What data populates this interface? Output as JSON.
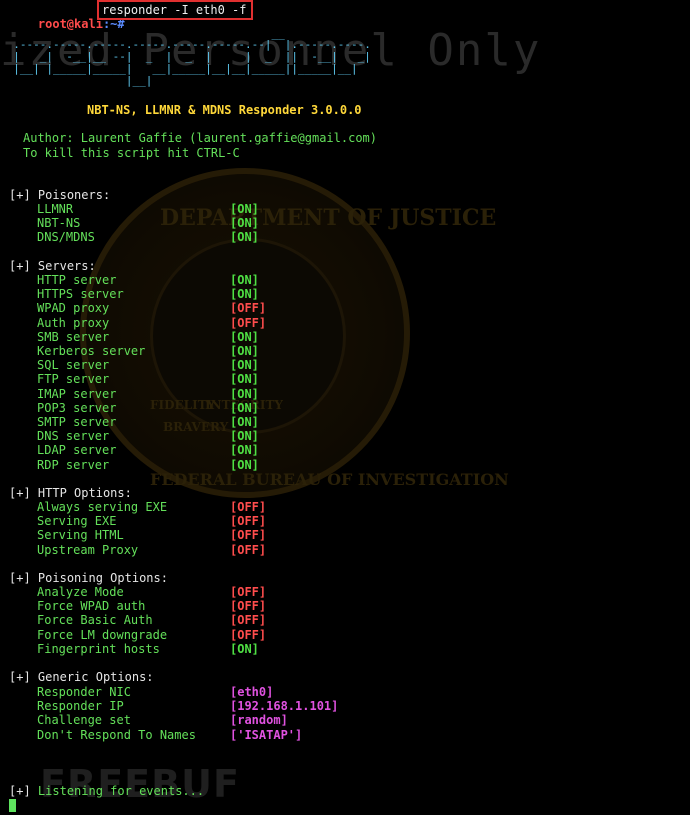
{
  "prompt": {
    "user": "root@kali",
    "path": ":~#",
    "command": "responder -I eth0 -f"
  },
  "watermarks": {
    "banner": "ized Personnel Only",
    "freebuf": "FREEBUF",
    "seal_top": "DEPARTMENT OF JUSTICE",
    "seal_bottom": "FEDERAL BUREAU OF INVESTIGATION",
    "seal_ribbon": [
      "FIDELITY",
      "BRAVERY",
      "INTEGRITY"
    ]
  },
  "banner": {
    "ascii": [
      "                                         __",
      "  .----.-----.-----.-----.-----.-----.--|  |.-----.----.",
      "  |   _|  -__|__ --|  _  |  _  |     |  _  ||  -__|   _|",
      "  |__| |_____|_____|   __|_____|__|__|_____||_____|__|",
      "                   |__|"
    ],
    "title": "NBT-NS, LLMNR & MDNS Responder 3.0.0.0",
    "author": "Author: Laurent Gaffie (laurent.gaffie@gmail.com)",
    "kill": "To kill this script hit CTRL-C"
  },
  "bullet": "[+]",
  "sections": {
    "poisoners": {
      "header": "Poisoners:",
      "items": [
        {
          "label": "LLMNR",
          "status": "[ON]"
        },
        {
          "label": "NBT-NS",
          "status": "[ON]"
        },
        {
          "label": "DNS/MDNS",
          "status": "[ON]"
        }
      ]
    },
    "servers": {
      "header": "Servers:",
      "items": [
        {
          "label": "HTTP server",
          "status": "[ON]"
        },
        {
          "label": "HTTPS server",
          "status": "[ON]"
        },
        {
          "label": "WPAD proxy",
          "status": "[OFF]"
        },
        {
          "label": "Auth proxy",
          "status": "[OFF]"
        },
        {
          "label": "SMB server",
          "status": "[ON]"
        },
        {
          "label": "Kerberos server",
          "status": "[ON]"
        },
        {
          "label": "SQL server",
          "status": "[ON]"
        },
        {
          "label": "FTP server",
          "status": "[ON]"
        },
        {
          "label": "IMAP server",
          "status": "[ON]"
        },
        {
          "label": "POP3 server",
          "status": "[ON]"
        },
        {
          "label": "SMTP server",
          "status": "[ON]"
        },
        {
          "label": "DNS server",
          "status": "[ON]"
        },
        {
          "label": "LDAP server",
          "status": "[ON]"
        },
        {
          "label": "RDP server",
          "status": "[ON]"
        }
      ]
    },
    "http_options": {
      "header": "HTTP Options:",
      "items": [
        {
          "label": "Always serving EXE",
          "status": "[OFF]"
        },
        {
          "label": "Serving EXE",
          "status": "[OFF]"
        },
        {
          "label": "Serving HTML",
          "status": "[OFF]"
        },
        {
          "label": "Upstream Proxy",
          "status": "[OFF]"
        }
      ]
    },
    "poisoning_options": {
      "header": "Poisoning Options:",
      "items": [
        {
          "label": "Analyze Mode",
          "status": "[OFF]"
        },
        {
          "label": "Force WPAD auth",
          "status": "[OFF]"
        },
        {
          "label": "Force Basic Auth",
          "status": "[OFF]"
        },
        {
          "label": "Force LM downgrade",
          "status": "[OFF]"
        },
        {
          "label": "Fingerprint hosts",
          "status": "[ON]"
        }
      ]
    },
    "generic_options": {
      "header": "Generic Options:",
      "items": [
        {
          "label": "Responder NIC",
          "value": "[eth0]"
        },
        {
          "label": "Responder IP",
          "value": "[192.168.1.101]"
        },
        {
          "label": "Challenge set",
          "value": "[random]"
        },
        {
          "label": "Don't Respond To Names",
          "value": "['ISATAP']"
        }
      ]
    }
  },
  "listening": "Listening for events...",
  "colors": {
    "on": "#4fe044",
    "off": "#ff4d4d",
    "value": "#e052e0",
    "label": "#64e05a",
    "title": "#ffd83a",
    "ascii": "#5ec8ee",
    "highlight_box": "#e03030"
  }
}
